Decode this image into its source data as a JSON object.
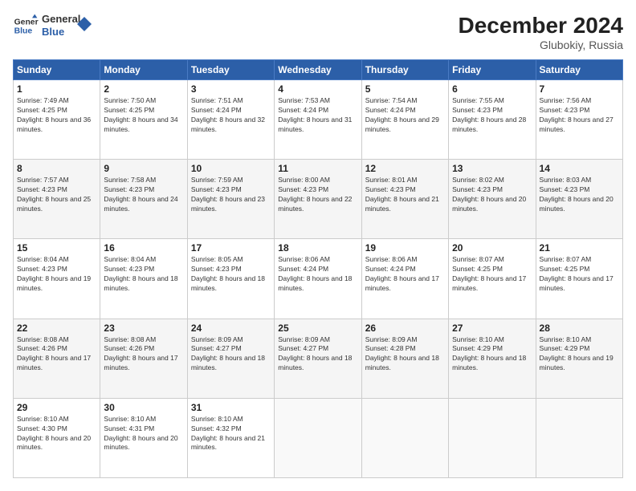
{
  "logo": {
    "line1": "General",
    "line2": "Blue"
  },
  "title": "December 2024",
  "location": "Glubokiy, Russia",
  "days_header": [
    "Sunday",
    "Monday",
    "Tuesday",
    "Wednesday",
    "Thursday",
    "Friday",
    "Saturday"
  ],
  "weeks": [
    [
      {
        "day": "1",
        "sunrise": "7:49 AM",
        "sunset": "4:25 PM",
        "daylight": "8 hours and 36 minutes."
      },
      {
        "day": "2",
        "sunrise": "7:50 AM",
        "sunset": "4:25 PM",
        "daylight": "8 hours and 34 minutes."
      },
      {
        "day": "3",
        "sunrise": "7:51 AM",
        "sunset": "4:24 PM",
        "daylight": "8 hours and 32 minutes."
      },
      {
        "day": "4",
        "sunrise": "7:53 AM",
        "sunset": "4:24 PM",
        "daylight": "8 hours and 31 minutes."
      },
      {
        "day": "5",
        "sunrise": "7:54 AM",
        "sunset": "4:24 PM",
        "daylight": "8 hours and 29 minutes."
      },
      {
        "day": "6",
        "sunrise": "7:55 AM",
        "sunset": "4:23 PM",
        "daylight": "8 hours and 28 minutes."
      },
      {
        "day": "7",
        "sunrise": "7:56 AM",
        "sunset": "4:23 PM",
        "daylight": "8 hours and 27 minutes."
      }
    ],
    [
      {
        "day": "8",
        "sunrise": "7:57 AM",
        "sunset": "4:23 PM",
        "daylight": "8 hours and 25 minutes."
      },
      {
        "day": "9",
        "sunrise": "7:58 AM",
        "sunset": "4:23 PM",
        "daylight": "8 hours and 24 minutes."
      },
      {
        "day": "10",
        "sunrise": "7:59 AM",
        "sunset": "4:23 PM",
        "daylight": "8 hours and 23 minutes."
      },
      {
        "day": "11",
        "sunrise": "8:00 AM",
        "sunset": "4:23 PM",
        "daylight": "8 hours and 22 minutes."
      },
      {
        "day": "12",
        "sunrise": "8:01 AM",
        "sunset": "4:23 PM",
        "daylight": "8 hours and 21 minutes."
      },
      {
        "day": "13",
        "sunrise": "8:02 AM",
        "sunset": "4:23 PM",
        "daylight": "8 hours and 20 minutes."
      },
      {
        "day": "14",
        "sunrise": "8:03 AM",
        "sunset": "4:23 PM",
        "daylight": "8 hours and 20 minutes."
      }
    ],
    [
      {
        "day": "15",
        "sunrise": "8:04 AM",
        "sunset": "4:23 PM",
        "daylight": "8 hours and 19 minutes."
      },
      {
        "day": "16",
        "sunrise": "8:04 AM",
        "sunset": "4:23 PM",
        "daylight": "8 hours and 18 minutes."
      },
      {
        "day": "17",
        "sunrise": "8:05 AM",
        "sunset": "4:23 PM",
        "daylight": "8 hours and 18 minutes."
      },
      {
        "day": "18",
        "sunrise": "8:06 AM",
        "sunset": "4:24 PM",
        "daylight": "8 hours and 18 minutes."
      },
      {
        "day": "19",
        "sunrise": "8:06 AM",
        "sunset": "4:24 PM",
        "daylight": "8 hours and 17 minutes."
      },
      {
        "day": "20",
        "sunrise": "8:07 AM",
        "sunset": "4:25 PM",
        "daylight": "8 hours and 17 minutes."
      },
      {
        "day": "21",
        "sunrise": "8:07 AM",
        "sunset": "4:25 PM",
        "daylight": "8 hours and 17 minutes."
      }
    ],
    [
      {
        "day": "22",
        "sunrise": "8:08 AM",
        "sunset": "4:26 PM",
        "daylight": "8 hours and 17 minutes."
      },
      {
        "day": "23",
        "sunrise": "8:08 AM",
        "sunset": "4:26 PM",
        "daylight": "8 hours and 17 minutes."
      },
      {
        "day": "24",
        "sunrise": "8:09 AM",
        "sunset": "4:27 PM",
        "daylight": "8 hours and 18 minutes."
      },
      {
        "day": "25",
        "sunrise": "8:09 AM",
        "sunset": "4:27 PM",
        "daylight": "8 hours and 18 minutes."
      },
      {
        "day": "26",
        "sunrise": "8:09 AM",
        "sunset": "4:28 PM",
        "daylight": "8 hours and 18 minutes."
      },
      {
        "day": "27",
        "sunrise": "8:10 AM",
        "sunset": "4:29 PM",
        "daylight": "8 hours and 18 minutes."
      },
      {
        "day": "28",
        "sunrise": "8:10 AM",
        "sunset": "4:29 PM",
        "daylight": "8 hours and 19 minutes."
      }
    ],
    [
      {
        "day": "29",
        "sunrise": "8:10 AM",
        "sunset": "4:30 PM",
        "daylight": "8 hours and 20 minutes."
      },
      {
        "day": "30",
        "sunrise": "8:10 AM",
        "sunset": "4:31 PM",
        "daylight": "8 hours and 20 minutes."
      },
      {
        "day": "31",
        "sunrise": "8:10 AM",
        "sunset": "4:32 PM",
        "daylight": "8 hours and 21 minutes."
      },
      null,
      null,
      null,
      null
    ]
  ]
}
